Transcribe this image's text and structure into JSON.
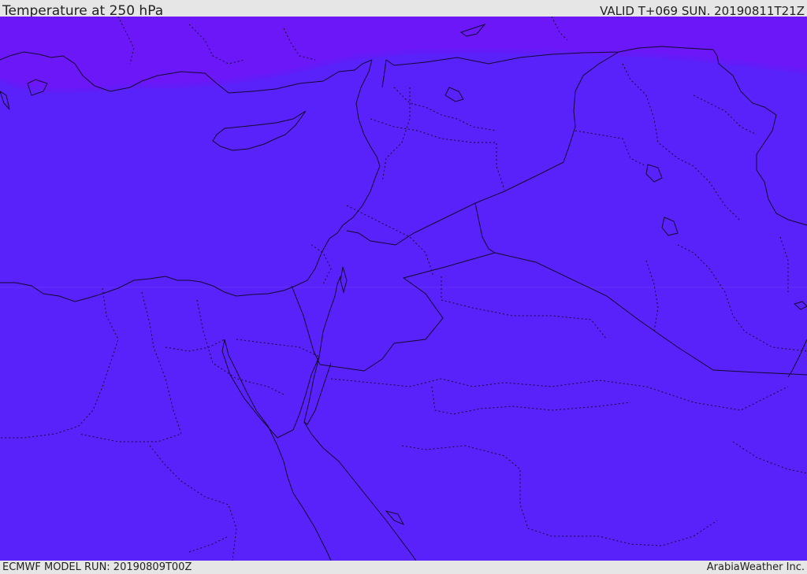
{
  "header": {
    "title": "Temperature at 250 hPa",
    "valid": "VALID T+069 SUN. 20190811T21Z"
  },
  "footer": {
    "model_run": "ECMWF MODEL RUN: 20190809T00Z",
    "credit": "ArabiaWeather Inc."
  },
  "colors": {
    "base_field": "#5922fb",
    "cold_band": "#6b17f7",
    "cold_band_edge": "#641bf8",
    "borders": "#1a0a4a",
    "frame": "#e6e6e6"
  }
}
